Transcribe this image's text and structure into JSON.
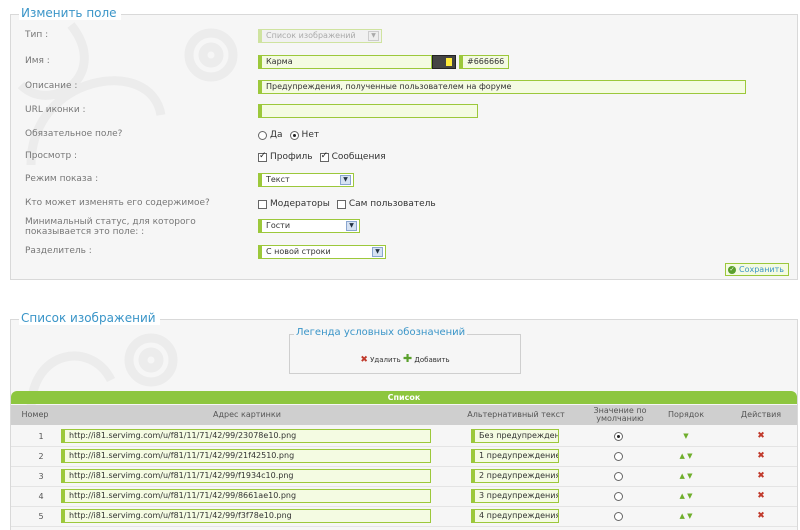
{
  "edit_field": {
    "title": "Изменить поле",
    "type_label": "Тип :",
    "type_value": "Список изображений",
    "name_label": "Имя :",
    "name_value": "Карма",
    "color_value": "#666666",
    "description_label": "Описание :",
    "description_value": "Предупреждения, полученные пользователем на форуме",
    "icon_url_label": "URL иконки :",
    "icon_url_value": "",
    "required_label": "Обязательное поле?",
    "required_yes": "Да",
    "required_no": "Нет",
    "required_selected": "Нет",
    "view_label": "Просмотр :",
    "view_profile": "Профиль",
    "view_messages": "Сообщения",
    "display_mode_label": "Режим показа :",
    "display_mode_value": "Текст",
    "who_can_edit_label": "Кто может изменять его содержимое?",
    "who_moderators": "Модераторы",
    "who_self": "Сам пользователь",
    "min_status_label": "Минимальный статус, для которого показывается это поле: :",
    "min_status_value": "Гости",
    "separator_label": "Разделитель :",
    "separator_value": "С новой строки",
    "save_label": "Сохранить"
  },
  "image_list": {
    "title": "Список изображений",
    "legend_title": "Легенда условных обозначений",
    "legend_delete": "Удалить",
    "legend_add": "Добавить",
    "table_title": "Список",
    "columns": {
      "number": "Номер",
      "url": "Адрес картинки",
      "alt": "Альтернативный текст",
      "default": "Значение по умолчанию",
      "order": "Порядок",
      "actions": "Действия"
    },
    "rows": [
      {
        "num": "1",
        "url": "http://i81.servimg.com/u/f81/11/71/42/99/23078e10.png",
        "alt": "Без предупреждений",
        "default": true,
        "order": "▼"
      },
      {
        "num": "2",
        "url": "http://i81.servimg.com/u/f81/11/71/42/99/21f42510.png",
        "alt": "1 предупреждение",
        "default": false,
        "order": "▲ ▼"
      },
      {
        "num": "3",
        "url": "http://i81.servimg.com/u/f81/11/71/42/99/f1934c10.png",
        "alt": "2 предупреждения",
        "default": false,
        "order": "▲ ▼"
      },
      {
        "num": "4",
        "url": "http://i81.servimg.com/u/f81/11/71/42/99/8661ae10.png",
        "alt": "3 предупреждения",
        "default": false,
        "order": "▲ ▼"
      },
      {
        "num": "5",
        "url": "http://i81.servimg.com/u/f81/11/71/42/99/f3f78e10.png",
        "alt": "4 предупреждения",
        "default": false,
        "order": "▲ ▼"
      }
    ]
  },
  "colors": {
    "accent_green": "#8dc63f",
    "title_blue": "#3a95c8",
    "delete_red": "#c0392b"
  }
}
